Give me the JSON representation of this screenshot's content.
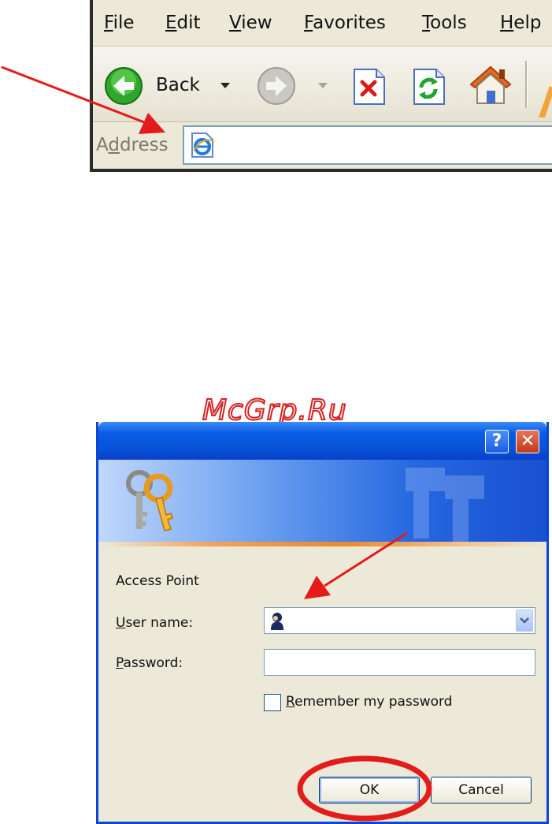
{
  "browser": {
    "menu": [
      "File",
      "Edit",
      "View",
      "Favorites",
      "Tools",
      "Help"
    ],
    "back_label": "Back",
    "address_label": "Address",
    "address_value": ""
  },
  "watermark": "McGrp.Ru",
  "dialog": {
    "help_glyph": "?",
    "close_glyph": "✕",
    "realm": "Access Point",
    "username_label": "User name:",
    "username_value": "",
    "password_label": "Password:",
    "password_value": "",
    "remember_label": "Remember my password",
    "remember_checked": false,
    "ok_label": "OK",
    "cancel_label": "Cancel"
  },
  "annotations": {
    "arrow_color": "#e31b1b",
    "highlight_color": "#e31b1b"
  }
}
